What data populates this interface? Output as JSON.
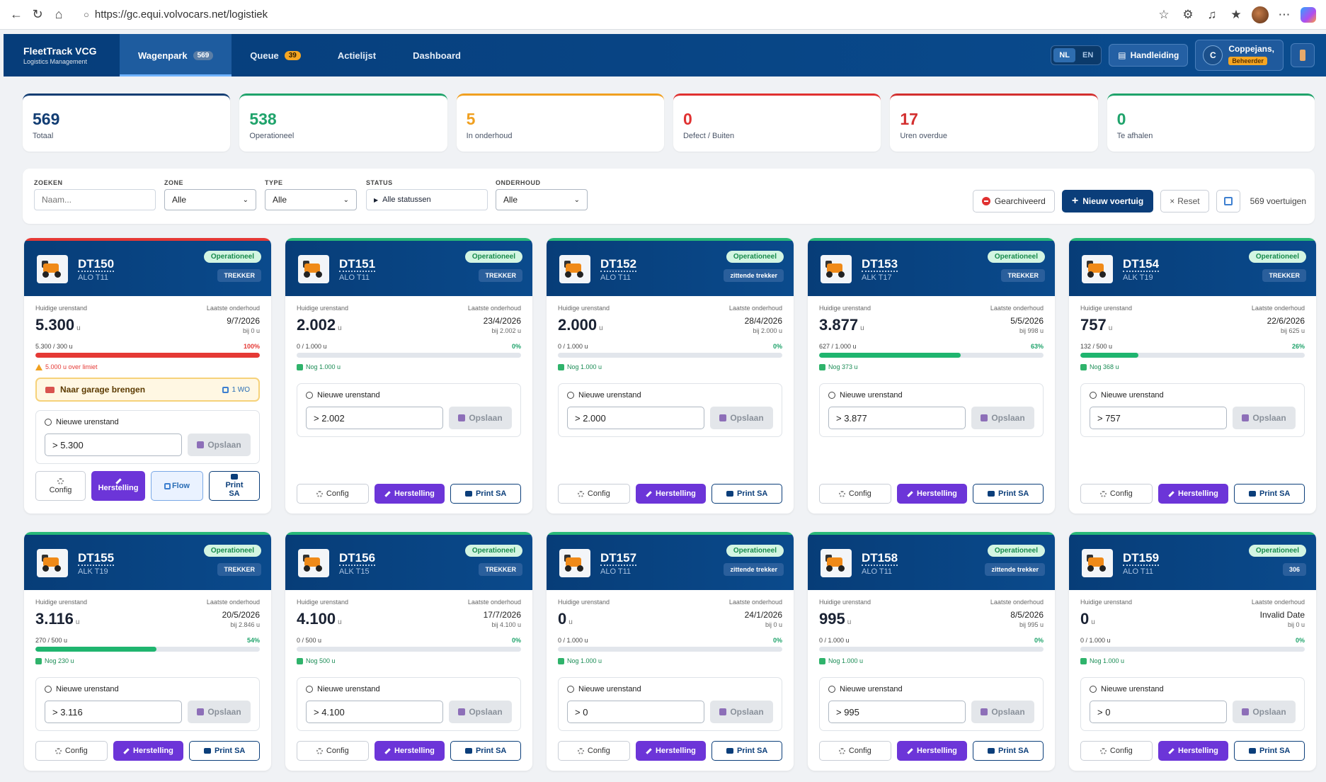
{
  "browser": {
    "url": "https://gc.equi.volvocars.net/logistiek"
  },
  "app": {
    "brand": "FleetTrack VCG",
    "brand_sub": "Logistics Management",
    "tabs": [
      {
        "label": "Wagenpark",
        "count": "569"
      },
      {
        "label": "Queue",
        "count": "39"
      },
      {
        "label": "Actielijst"
      },
      {
        "label": "Dashboard"
      }
    ],
    "lang_nl": "NL",
    "lang_en": "EN",
    "manual_label": "Handleiding",
    "user_initial": "C",
    "user_name": "Coppejans,",
    "user_role": "Beheerder"
  },
  "stats": [
    {
      "value": "569",
      "label": "Totaal",
      "color": "#123d73"
    },
    {
      "value": "538",
      "label": "Operationeel",
      "color": "#1fa36b"
    },
    {
      "value": "5",
      "label": "In onderhoud",
      "color": "#f0a020"
    },
    {
      "value": "0",
      "label": "Defect / Buiten",
      "color": "#e03131"
    },
    {
      "value": "17",
      "label": "Uren overdue",
      "color": "#d32f2f"
    },
    {
      "value": "0",
      "label": "Te afhalen",
      "color": "#1fa36b"
    }
  ],
  "filters": {
    "search_label": "ZOEKEN",
    "search_placeholder": "Naam...",
    "zone_label": "ZONE",
    "zone_value": "Alle",
    "type_label": "TYPE",
    "type_value": "Alle",
    "status_label": "STATUS",
    "status_value": "Alle statussen",
    "maint_label": "ONDERHOUD",
    "maint_value": "Alle",
    "archived_label": "Gearchiveerd",
    "new_label": "Nieuw voertuig",
    "reset_label": "Reset",
    "count_text": "569 voertuigen"
  },
  "labels": {
    "current_hours": "Huidige urenstand",
    "last_maint": "Laatste onderhoud",
    "unit": "u",
    "new_hours": "Nieuwe urenstand",
    "save": "Opslaan",
    "config": "Config",
    "repair": "Herstelling",
    "print": "Print SA",
    "flow": "Flow",
    "garage": "Naar garage brengen",
    "wo": "1 WO"
  },
  "vehicles": [
    {
      "name": "DT150",
      "model": "ALO T11",
      "status": "Operationeel",
      "type": "TREKKER",
      "hours": "5.300",
      "last_date": "9/7/2026",
      "last_at": "bij 0 u",
      "progress_text": "5.300 / 300 u",
      "pct": "100%",
      "fraction": 1.0,
      "remain": "5.000 u over limiet",
      "input": "> 5.300",
      "alert": true
    },
    {
      "name": "DT151",
      "model": "ALO T11",
      "status": "Operationeel",
      "type": "TREKKER",
      "hours": "2.002",
      "last_date": "23/4/2026",
      "last_at": "bij 2.002 u",
      "progress_text": "0 / 1.000 u",
      "pct": "0%",
      "fraction": 0.0,
      "remain": "Nog 1.000 u",
      "input": "> 2.002"
    },
    {
      "name": "DT152",
      "model": "ALO T11",
      "status": "Operationeel",
      "type": "zittende trekker",
      "hours": "2.000",
      "last_date": "28/4/2026",
      "last_at": "bij 2.000 u",
      "progress_text": "0 / 1.000 u",
      "pct": "0%",
      "fraction": 0.0,
      "remain": "Nog 1.000 u",
      "input": "> 2.000"
    },
    {
      "name": "DT153",
      "model": "ALK T17",
      "status": "Operationeel",
      "type": "TREKKER",
      "hours": "3.877",
      "last_date": "5/5/2026",
      "last_at": "bij 998 u",
      "progress_text": "627 / 1.000 u",
      "pct": "63%",
      "fraction": 0.63,
      "remain": "Nog 373 u",
      "input": "> 3.877"
    },
    {
      "name": "DT154",
      "model": "ALK T19",
      "status": "Operationeel",
      "type": "TREKKER",
      "hours": "757",
      "last_date": "22/6/2026",
      "last_at": "bij 625 u",
      "progress_text": "132 / 500 u",
      "pct": "26%",
      "fraction": 0.26,
      "remain": "Nog 368 u",
      "input": "> 757"
    },
    {
      "name": "DT155",
      "model": "ALK T19",
      "status": "Operationeel",
      "type": "TREKKER",
      "hours": "3.116",
      "last_date": "20/5/2026",
      "last_at": "bij 2.846 u",
      "progress_text": "270 / 500 u",
      "pct": "54%",
      "fraction": 0.54,
      "remain": "Nog 230 u",
      "input": "> 3.116"
    },
    {
      "name": "DT156",
      "model": "ALK T15",
      "status": "Operationeel",
      "type": "TREKKER",
      "hours": "4.100",
      "last_date": "17/7/2026",
      "last_at": "bij 4.100 u",
      "progress_text": "0 / 500 u",
      "pct": "0%",
      "fraction": 0.0,
      "remain": "Nog 500 u",
      "input": "> 4.100"
    },
    {
      "name": "DT157",
      "model": "ALO T11",
      "status": "Operationeel",
      "type": "zittende trekker",
      "hours": "0",
      "last_date": "24/1/2026",
      "last_at": "bij 0 u",
      "progress_text": "0 / 1.000 u",
      "pct": "0%",
      "fraction": 0.0,
      "remain": "Nog 1.000 u",
      "input": "> 0"
    },
    {
      "name": "DT158",
      "model": "ALO T11",
      "status": "Operationeel",
      "type": "zittende trekker",
      "hours": "995",
      "last_date": "8/5/2026",
      "last_at": "bij 995 u",
      "progress_text": "0 / 1.000 u",
      "pct": "0%",
      "fraction": 0.0,
      "remain": "Nog 1.000 u",
      "input": "> 995"
    },
    {
      "name": "DT159",
      "model": "ALO T11",
      "status": "Operationeel",
      "type": "306",
      "hours": "0",
      "last_date": "Invalid Date",
      "last_at": "bij 0 u",
      "progress_text": "0 / 1.000 u",
      "pct": "0%",
      "fraction": 0.0,
      "remain": "Nog 1.000 u",
      "input": "> 0"
    }
  ]
}
